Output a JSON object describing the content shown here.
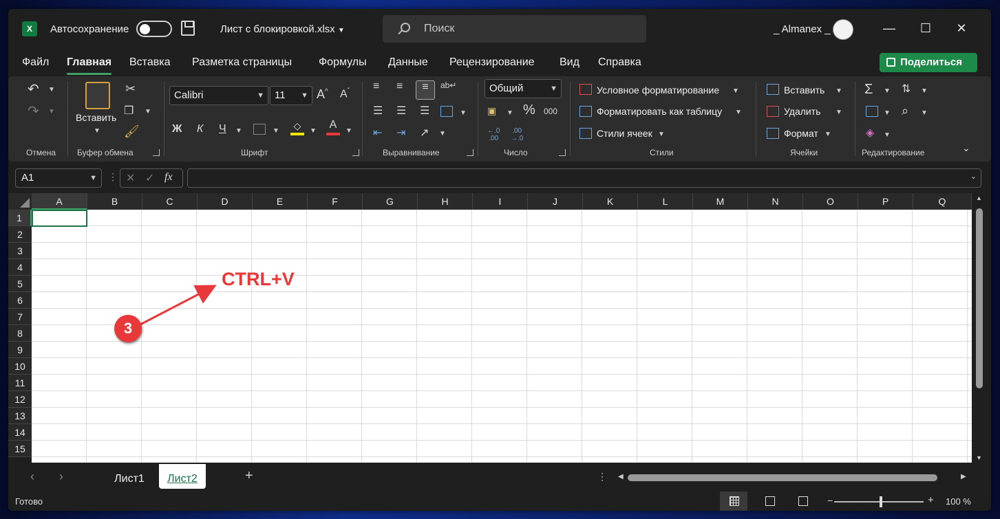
{
  "titlebar": {
    "app_icon": "X",
    "autosave_label": "Автосохранение",
    "autosave_on": false,
    "filename": "Лист с блокировкой.xlsx",
    "search_placeholder": "Поиск",
    "user": "_ Almanex _",
    "minimize": "—",
    "maximize": "☐",
    "close": "✕"
  },
  "menu": {
    "items": [
      "Файл",
      "Главная",
      "Вставка",
      "Разметка страницы",
      "Формулы",
      "Данные",
      "Рецензирование",
      "Вид",
      "Справка"
    ],
    "active": "Главная",
    "share": "Поделиться"
  },
  "ribbon": {
    "undo_group": "Отмена",
    "clipboard": {
      "label": "Буфер обмена",
      "paste": "Вставить"
    },
    "font": {
      "label": "Шрифт",
      "name": "Calibri",
      "size": "11",
      "bold": "Ж",
      "italic": "К",
      "underline": "Ч",
      "grow": "A^",
      "shrink": "A˅",
      "color_letter": "A"
    },
    "alignment": {
      "label": "Выравнивание"
    },
    "number": {
      "label": "Число",
      "format": "Общий",
      "percent": "%",
      "thousands": "000"
    },
    "styles": {
      "label": "Стили",
      "conditional": "Условное форматирование",
      "as_table": "Форматировать как таблицу",
      "cell_styles": "Стили ячеек"
    },
    "cells": {
      "label": "Ячейки",
      "insert": "Вставить",
      "delete": "Удалить",
      "format": "Формат"
    },
    "editing": {
      "label": "Редактирование"
    }
  },
  "formula_bar": {
    "name_box": "A1",
    "fx": "fx",
    "value": ""
  },
  "grid": {
    "columns": [
      "A",
      "B",
      "C",
      "D",
      "E",
      "F",
      "G",
      "H",
      "I",
      "J",
      "K",
      "L",
      "M",
      "N",
      "O",
      "P",
      "Q"
    ],
    "rows": [
      "1",
      "2",
      "3",
      "4",
      "5",
      "6",
      "7",
      "8",
      "9",
      "10",
      "11",
      "12",
      "13",
      "14",
      "15"
    ],
    "selected": "A1"
  },
  "annotation": {
    "text": "CTRL+V",
    "step": "3"
  },
  "sheets": {
    "tabs": [
      "Лист1",
      "Лист2"
    ],
    "active": "Лист2",
    "add": "+",
    "prev": "‹",
    "next": "›"
  },
  "status": {
    "text": "Готово",
    "zoom": "100 %",
    "zoom_minus": "−",
    "zoom_plus": "+"
  },
  "colors": {
    "accent": "#1e8a4a",
    "annotation": "#e8383a",
    "selection": "#1e7145"
  }
}
